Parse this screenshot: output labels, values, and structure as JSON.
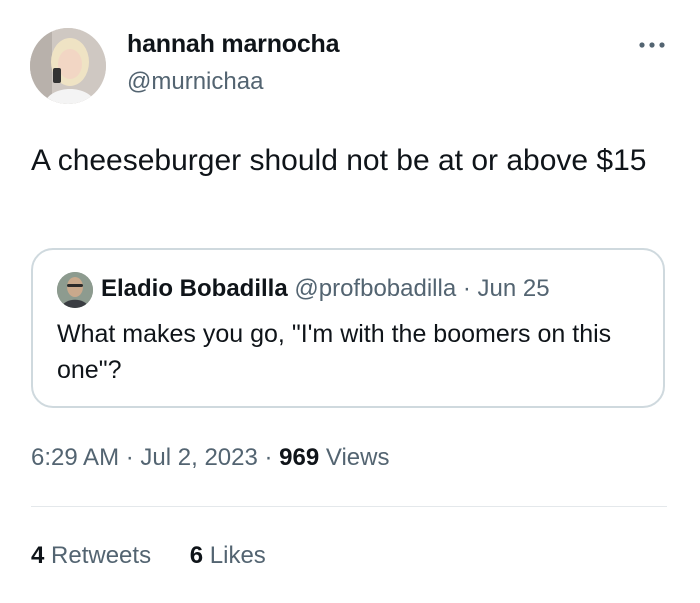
{
  "author": {
    "display_name": "hannah marnocha",
    "handle": "@murnichaa"
  },
  "tweet": {
    "text": "A cheeseburger should not be at or above $15"
  },
  "quoted_tweet": {
    "display_name": "Eladio Bobadilla",
    "handle": "@profbobadilla",
    "separator": "·",
    "date": "Jun 25",
    "text": "What makes you go, \"I'm with the boomers on this one\"?"
  },
  "meta": {
    "time": "6:29 AM",
    "separator": "·",
    "date": "Jul 2, 2023",
    "views_count": "969",
    "views_label": "Views"
  },
  "stats": {
    "retweets_count": "4",
    "retweets_label": "Retweets",
    "likes_count": "6",
    "likes_label": "Likes"
  },
  "icons": {
    "more": "more-horizontal-icon"
  },
  "colors": {
    "text_primary": "#0f1419",
    "text_secondary": "#536471",
    "border": "#cfd9de"
  }
}
